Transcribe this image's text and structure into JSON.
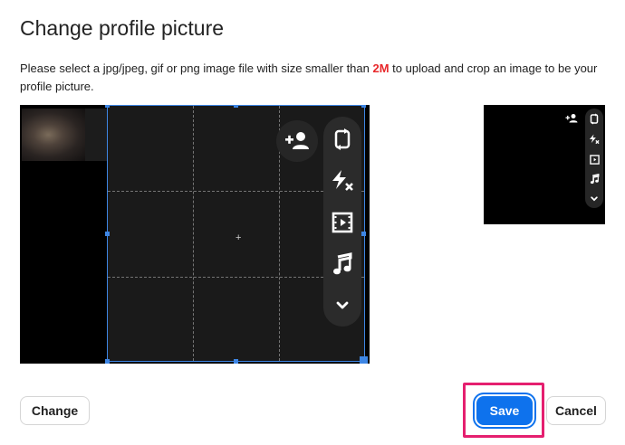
{
  "dialog": {
    "title": "Change profile picture",
    "desc_before": "Please select a jpg/jpeg, gif or png image file with size smaller than ",
    "size_limit": "2M",
    "desc_after": " to upload and crop an image to be your profile picture.",
    "accent_color": "#0e72ed",
    "limit_color": "#e8282b",
    "highlight_color": "#e51f6f"
  },
  "cropper": {
    "center_marker": "+",
    "icons": [
      "add-user-icon",
      "rotate-icon",
      "flash-off-icon",
      "video-icon",
      "music-icon",
      "chevron-down-icon"
    ],
    "preview_icons": [
      "add-user-icon",
      "rotate-icon",
      "flash-off-icon",
      "video-icon",
      "music-icon",
      "chevron-down-icon"
    ]
  },
  "buttons": {
    "change": "Change",
    "save": "Save",
    "cancel": "Cancel"
  }
}
